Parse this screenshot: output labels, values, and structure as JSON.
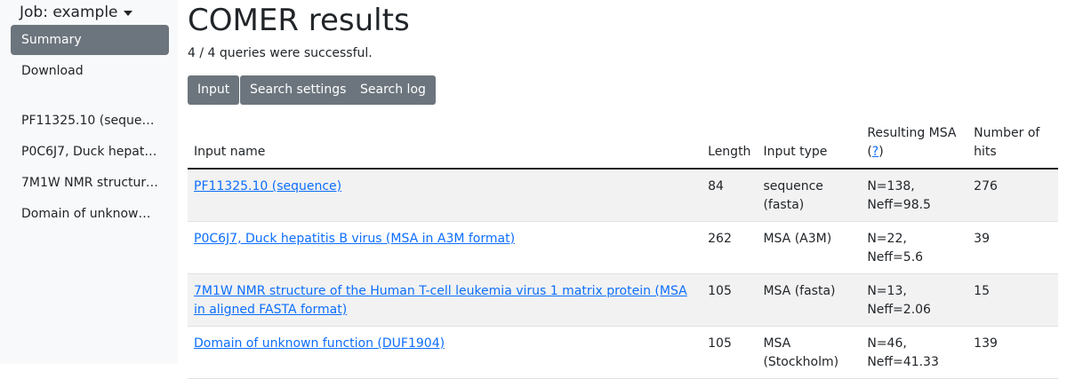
{
  "sidebar": {
    "job_label": "Job: example",
    "nav": [
      {
        "label": "Summary"
      },
      {
        "label": "Download"
      }
    ],
    "queries": [
      {
        "label": "PF11325.10 (sequence)"
      },
      {
        "label": "P0C6J7, Duck hepatitis B virus (MSA in A3M format)"
      },
      {
        "label": "7M1W NMR structure of the Human T-cell leukemia virus 1 matrix protein (MSA in aligned FASTA format)"
      },
      {
        "label": "Domain of unknown function (DUF1904)"
      }
    ]
  },
  "main": {
    "title": "COMER results",
    "status": "4 / 4 queries were successful.",
    "buttons": {
      "input": "Input",
      "search_settings": "Search settings",
      "search_log": "Search log"
    },
    "table": {
      "headers": {
        "input_name": "Input name",
        "length": "Length",
        "input_type": "Input type",
        "resulting_msa": "Resulting MSA",
        "help_mark": "?",
        "num_hits_1": "Number of",
        "num_hits_2": "hits"
      },
      "rows": [
        {
          "name": "PF11325.10 (sequence)",
          "length": "84",
          "type_1": "sequence",
          "type_2": "(fasta)",
          "msa_1": "N=138,",
          "msa_2": "Neff=98.5",
          "hits": "276"
        },
        {
          "name": "P0C6J7, Duck hepatitis B virus (MSA in A3M format)",
          "length": "262",
          "type_1": "MSA (A3M)",
          "type_2": "",
          "msa_1": "N=22, Neff=5.6",
          "msa_2": "",
          "hits": "39"
        },
        {
          "name": "7M1W NMR structure of the Human T-cell leukemia virus 1 matrix protein (MSA in aligned FASTA format)",
          "length": "105",
          "type_1": "MSA (fasta)",
          "type_2": "",
          "msa_1": "N=13, Neff=2.06",
          "msa_2": "",
          "hits": "15"
        },
        {
          "name": "Domain of unknown function (DUF1904)",
          "length": "105",
          "type_1": "MSA",
          "type_2": "(Stockholm)",
          "msa_1": "N=46,",
          "msa_2": "Neff=41.33",
          "hits": "139"
        }
      ]
    }
  }
}
